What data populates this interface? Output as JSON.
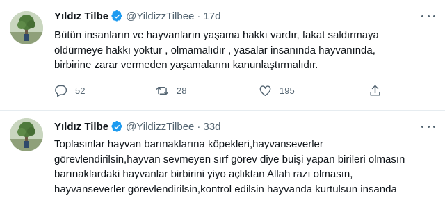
{
  "tweets": [
    {
      "name": "Yıldız Tilbe",
      "handle": "@YildizzTilbee",
      "separator": "·",
      "time": "17d",
      "text": "Bütün insanların ve hayvanların  yaşama hakkı vardır, fakat saldırmaya\nöldürmeye hakkı yoktur , olmamalıdır , yasalar insanında  hayvanında,\nbirbirine zarar vermeden yaşamalarını  kanunlaştırmalıdır.",
      "replies": "52",
      "retweets": "28",
      "likes": "195"
    },
    {
      "name": "Yıldız Tilbe",
      "handle": "@YildizzTilbee",
      "separator": "·",
      "time": "33d",
      "text": "Toplasınlar hayvan barınaklarına köpekleri,hayvanseverler\ngörevlendirilsin,hayvan sevmeyen sırf görev diye buişi yapan birileri olmasın\nbarınaklardaki hayvanlar birbirini yiyo açlıktan Allah razı olmasın,\nhayvanseverler görevlendirilsin,kontrol edilsin hayvanda kurtulsun insanda"
    }
  ],
  "colors": {
    "verified": "#1d9bf0",
    "muted": "#536471",
    "text": "#0f1419"
  }
}
